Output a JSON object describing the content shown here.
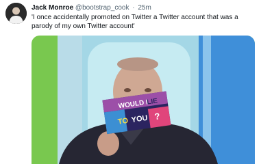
{
  "tweet": {
    "author_name": "Jack Monroe",
    "author_handle": "@bootstrap_cook",
    "separator": "·",
    "timestamp": "25m",
    "text": "'I once accidentally promoted on Twitter a Twitter account that was a parody of my own Twitter account'",
    "avatar_icon": "profile-photo",
    "media": {
      "card_line1_a": "WOULD I",
      "card_line1_b": "LIE",
      "card_line2_a": "TO",
      "card_line2_b": "YOU",
      "card_line2_c": "?"
    }
  }
}
